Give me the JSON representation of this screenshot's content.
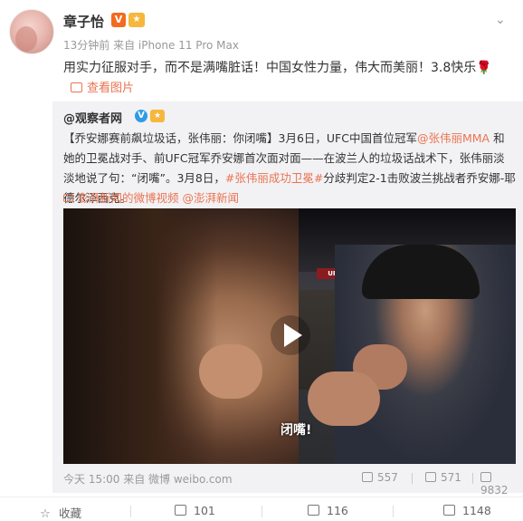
{
  "post": {
    "username": "章子怡",
    "v_badge": "V",
    "level_badge": "🐝",
    "meta": "13分钟前 来自 iPhone 11 Pro Max",
    "text": "用实力征服对手，而不是满嘴脏话！中国女性力量，伟大而美丽！3.8快乐",
    "emoji": "🌹",
    "see_pic": "查看图片"
  },
  "quote": {
    "author": "@观察者网",
    "v_badge": "V",
    "level_badge": "🐝",
    "text_part1": "【乔安娜赛前飙垃圾话，张伟丽：你闭嘴】3月6日，UFC中国首位冠军",
    "mention": "@张伟丽MMA",
    "text_part2": " 和她的卫冕战对手、前UFC冠军乔安娜首次面对面——在波兰人的垃圾话战术下，张伟丽淡淡地说了句：“闭嘴”。3月8日，",
    "hashtag": "#张伟丽成功卫冕#",
    "text_part3": "分歧判定2-1击败波兰挑战者乔安娜-耶德尔泽西克。",
    "source": "澎湃新闻的微博视频 @澎湃新闻",
    "video_subtitle": "闭嘴!",
    "video_sign": "UFC",
    "foot_time": "今天 15:00 来自 微博 weibo.com",
    "reposts": "557",
    "comments": "571",
    "likes": "9832"
  },
  "actions": {
    "favorite": "收藏",
    "repost": "101",
    "comment": "116",
    "like": "1148"
  },
  "colors": {
    "accent": "#eb7350",
    "quote_bg": "#f2f2f5",
    "verified_orange": "#f26b1f",
    "verified_blue": "#2f9be5"
  }
}
